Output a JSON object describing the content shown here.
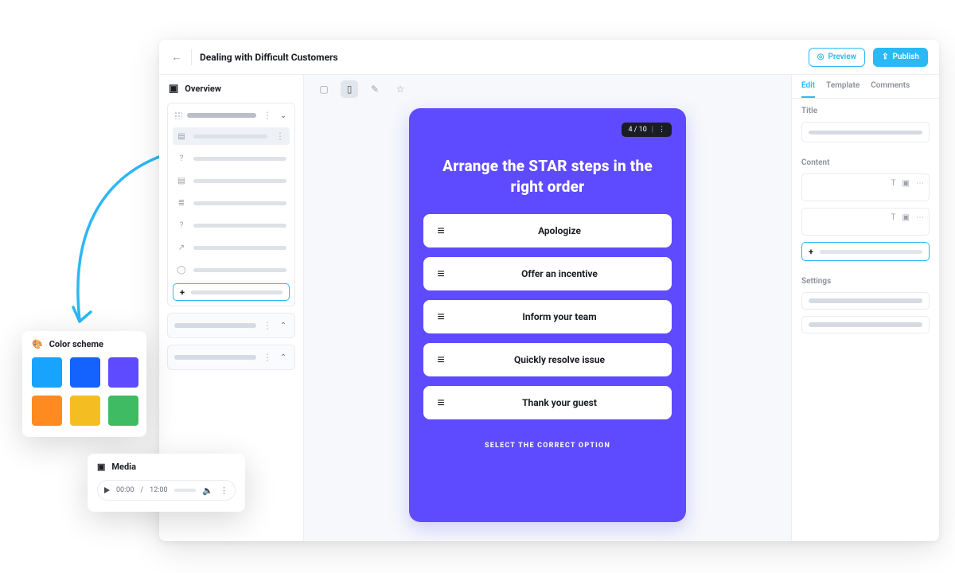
{
  "header": {
    "course_title": "Dealing with Difficult Customers",
    "preview_label": "Preview",
    "publish_label": "Publish"
  },
  "sidebar": {
    "title": "Overview"
  },
  "canvas": {
    "progress": "4 / 10",
    "heading": "Arrange the STAR steps in the right order",
    "options": [
      "Apologize",
      "Offer an incentive",
      "Inform your team",
      "Quickly resolve issue",
      "Thank your guest"
    ],
    "footer": "SELECT THE CORRECT OPTION"
  },
  "inspector": {
    "tabs": {
      "edit": "Edit",
      "template": "Template",
      "comments": "Comments"
    },
    "title_label": "Title",
    "content_label": "Content",
    "settings_label": "Settings"
  },
  "popovers": {
    "color_scheme": {
      "title": "Color scheme",
      "swatches": [
        "#18a3ff",
        "#1463ff",
        "#5f4bff",
        "#ff8a1f",
        "#f4bd22",
        "#3fbb63"
      ]
    },
    "media": {
      "title": "Media",
      "time_current": "00:00",
      "time_total": "12:00"
    }
  }
}
